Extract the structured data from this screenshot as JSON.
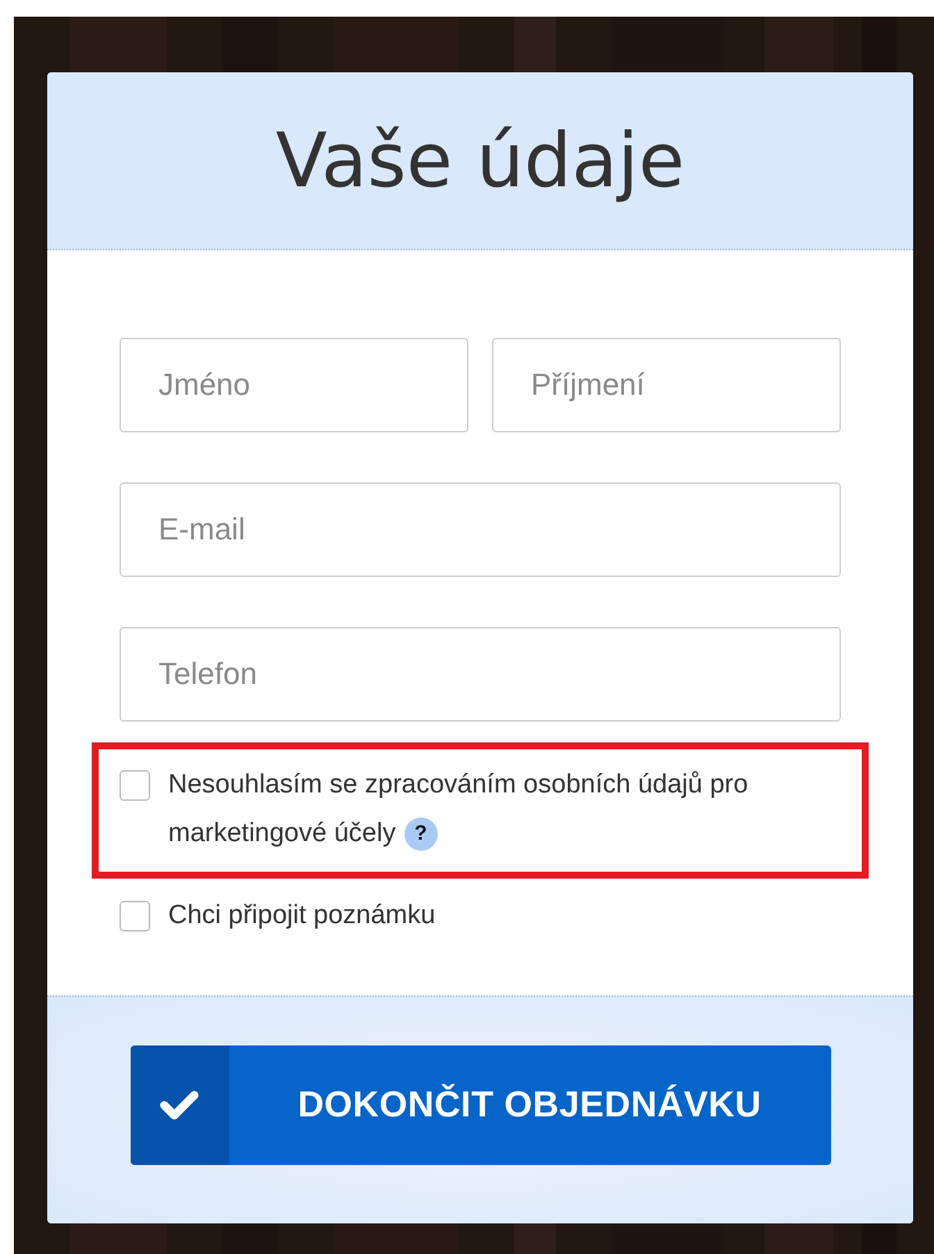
{
  "form": {
    "title": "Vaše údaje",
    "field_rows": [
      [
        {
          "placeholder": "Jméno"
        },
        {
          "placeholder": "Příjmení"
        }
      ],
      [
        {
          "placeholder": "E-mail"
        }
      ],
      [
        {
          "placeholder": "Telefon"
        }
      ]
    ],
    "checkboxes": [
      {
        "label": "Nesouhlasím se zpracováním osobních údajů pro marketingové účely",
        "checked": false,
        "help": "?",
        "highlighted": true
      },
      {
        "label": "Chci připojit poznámku",
        "checked": false,
        "highlighted": false
      }
    ],
    "submit_button": {
      "label": "DOKONČIT OBJEDNÁVKU"
    }
  }
}
